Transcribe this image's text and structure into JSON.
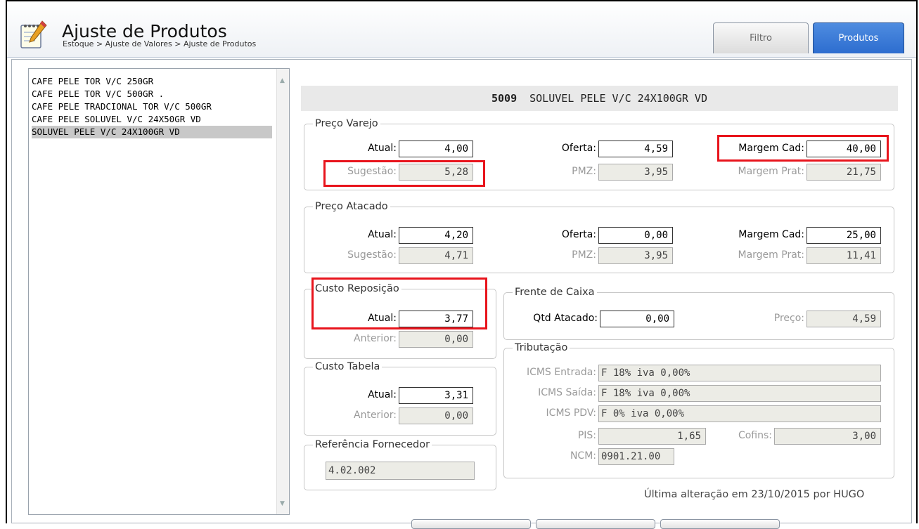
{
  "header": {
    "title": "Ajuste de Produtos",
    "breadcrumb": "Estoque > Ajuste de Valores > Ajuste de Produtos",
    "tabs": [
      {
        "label": "Filtro",
        "active": false
      },
      {
        "label": "Produtos",
        "active": true
      }
    ]
  },
  "product_list": {
    "items": [
      {
        "label": "CAFE PELE TOR V/C 250GR",
        "selected": false
      },
      {
        "label": "CAFE PELE TOR V/C 500GR .",
        "selected": false
      },
      {
        "label": "CAFE PELE TRADCIONAL TOR V/C 500GR",
        "selected": false
      },
      {
        "label": "CAFE PELE SOLUVEL V/C 24X50GR VD",
        "selected": false
      },
      {
        "label": "SOLUVEL PELE V/C 24X100GR VD",
        "selected": true
      }
    ]
  },
  "product": {
    "code": "5009",
    "name": "SOLUVEL PELE V/C 24X100GR VD"
  },
  "preco_varejo": {
    "legend": "Preço Varejo",
    "atual_label": "Atual:",
    "atual": "4,00",
    "sugestao_label": "Sugestão:",
    "sugestao": "5,28",
    "oferta_label": "Oferta:",
    "oferta": "4,59",
    "pmz_label": "PMZ:",
    "pmz": "3,95",
    "margem_cad_label": "Margem Cad:",
    "margem_cad": "40,00",
    "margem_prat_label": "Margem Prat:",
    "margem_prat": "21,75"
  },
  "preco_atacado": {
    "legend": "Preço Atacado",
    "atual_label": "Atual:",
    "atual": "4,20",
    "sugestao_label": "Sugestão:",
    "sugestao": "4,71",
    "oferta_label": "Oferta:",
    "oferta": "0,00",
    "pmz_label": "PMZ:",
    "pmz": "3,95",
    "margem_cad_label": "Margem Cad:",
    "margem_cad": "25,00",
    "margem_prat_label": "Margem Prat:",
    "margem_prat": "11,41"
  },
  "custo_reposicao": {
    "legend": "Custo Reposição",
    "atual_label": "Atual:",
    "atual": "3,77",
    "anterior_label": "Anterior:",
    "anterior": "0,00"
  },
  "custo_tabela": {
    "legend": "Custo Tabela",
    "atual_label": "Atual:",
    "atual": "3,31",
    "anterior_label": "Anterior:",
    "anterior": "0,00"
  },
  "referencia_fornecedor": {
    "legend": "Referência Fornecedor",
    "value": "4.02.002"
  },
  "frente_caixa": {
    "legend": "Frente de Caixa",
    "qtd_label": "Qtd Atacado:",
    "qtd": "0,00",
    "preco_label": "Preço:",
    "preco": "4,59"
  },
  "tributacao": {
    "legend": "Tributação",
    "icms_entrada_label": "ICMS Entrada:",
    "icms_entrada": "F 18% iva 0,00%",
    "icms_saida_label": "ICMS Saída:",
    "icms_saida": "F 18% iva 0,00%",
    "icms_pdv_label": "ICMS PDV:",
    "icms_pdv": "F 0% iva 0,00%",
    "pis_label": "PIS:",
    "pis": "1,65",
    "cofins_label": "Cofins:",
    "cofins": "3,00",
    "ncm_label": "NCM:",
    "ncm": "0901.21.00"
  },
  "footer": {
    "last_change": "Última alteração em 23/10/2015 por HUGO"
  },
  "colors": {
    "highlight_box": "#e8141c",
    "active_tab": "#2d6dcf",
    "selected_row": "#c8c8c8"
  }
}
